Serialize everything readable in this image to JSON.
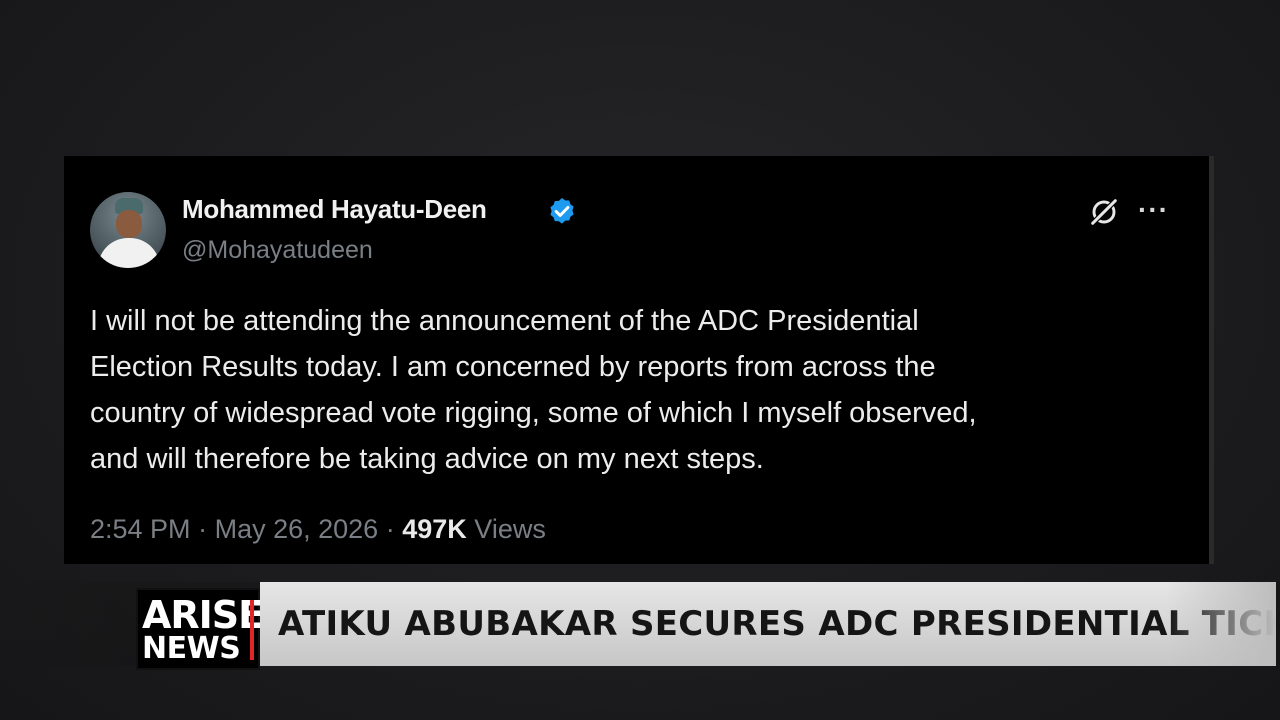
{
  "tweet": {
    "author_name": "Mohammed Hayatu-Deen",
    "handle": "@Mohayatudeen",
    "verified": true,
    "accent_color": "#1d9bf0",
    "text_lines": [
      "I will not be attending the announcement of the ADC Presidential",
      "Election Results today. I am concerned by reports from across the",
      "country of widespread vote rigging, some of which I myself observed,",
      "and will therefore be taking advice on my next steps."
    ],
    "time": "2:54 PM",
    "date": "May 26, 2026",
    "separator": "·",
    "views_count": "497K",
    "views_label": "Views",
    "more_label": "···"
  },
  "broadcast": {
    "logo_top": "ARISE",
    "logo_bottom": "NEWS",
    "logo_accent": "#e0262a",
    "headline": "ATIKU ABUBAKAR SECURES ADC PRESIDENTIAL TICKET"
  }
}
